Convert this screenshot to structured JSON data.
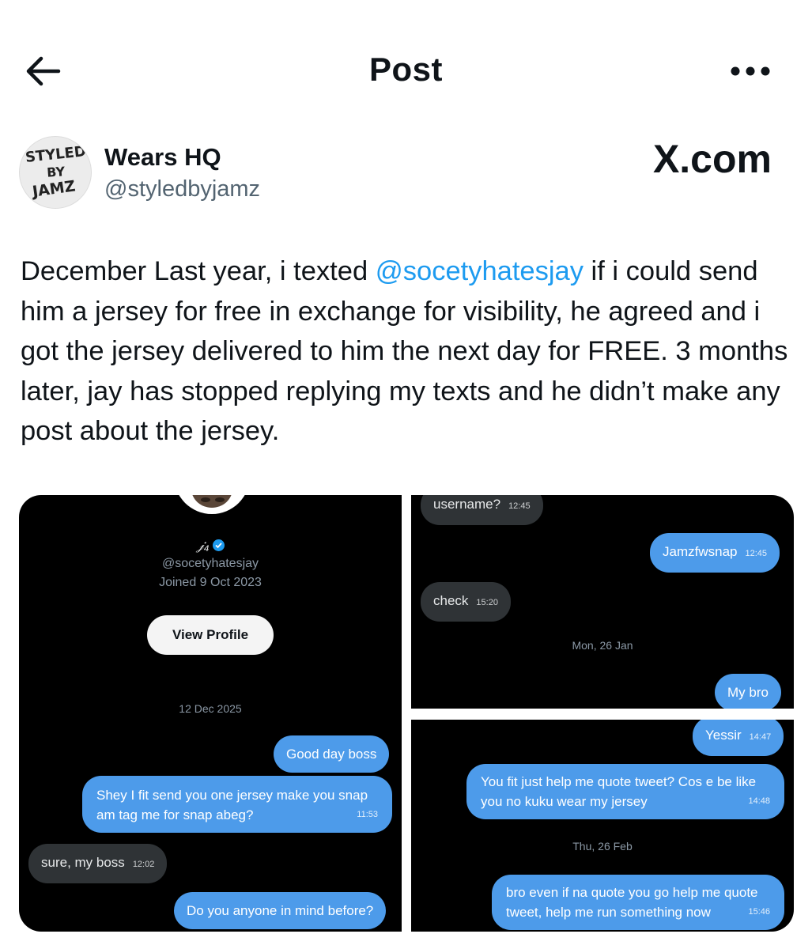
{
  "header": {
    "title": "Post"
  },
  "author": {
    "name": "Wears HQ",
    "handle": "@styledbyjamz",
    "avatar_text": "STYLED BY JAMZ"
  },
  "watermark": {
    "text": "X.com"
  },
  "post": {
    "before_mention": "December Last year, i texted ",
    "mention": "@socetyhatesjay",
    "after_mention": " if i could send him a jersey for free in exchange for visibility, he agreed and i got the jersey delivered to him the next day for FREE. 3 months later, jay has stopped replying my texts and he didn’t make any post about the jersey."
  },
  "media": {
    "panel1": {
      "profile_name": "𝒿₄",
      "profile_handle": "@socetyhatesjay",
      "joined": "Joined 9 Oct 2023",
      "view_profile_label": "View Profile",
      "date_separator": "12 Dec 2025",
      "messages": [
        {
          "text": "Good day boss",
          "time": ""
        },
        {
          "text": "Shey I fit send you one jersey make you snap am tag me for snap abeg?",
          "time": "11:53"
        },
        {
          "text": "sure, my boss",
          "time": "12:02"
        },
        {
          "text": "Do you anyone in mind before?",
          "time": ""
        }
      ]
    },
    "panel2": {
      "date_separator": "Mon, 26 Jan",
      "messages": [
        {
          "text": "username?",
          "time": "12:45"
        },
        {
          "text": "Jamzfwsnap",
          "time": "12:45"
        },
        {
          "text": "check",
          "time": "15:20"
        },
        {
          "text": "My bro",
          "time": ""
        }
      ]
    },
    "panel3": {
      "date_separator": "Thu, 26 Feb",
      "messages": [
        {
          "text": "Yessir",
          "time": "14:47"
        },
        {
          "text": "You fit just help me quote tweet? Cos e be like you no kuku wear my jersey",
          "time": "14:48"
        },
        {
          "text": "bro even if na quote you go help me quote tweet, help me run something now",
          "time": "15:46"
        }
      ]
    }
  },
  "colors": {
    "mention": "#1d9bf0",
    "outgoing_bubble": "#4d9bea",
    "incoming_bubble": "#2f3336",
    "secondary_text": "#536471"
  }
}
